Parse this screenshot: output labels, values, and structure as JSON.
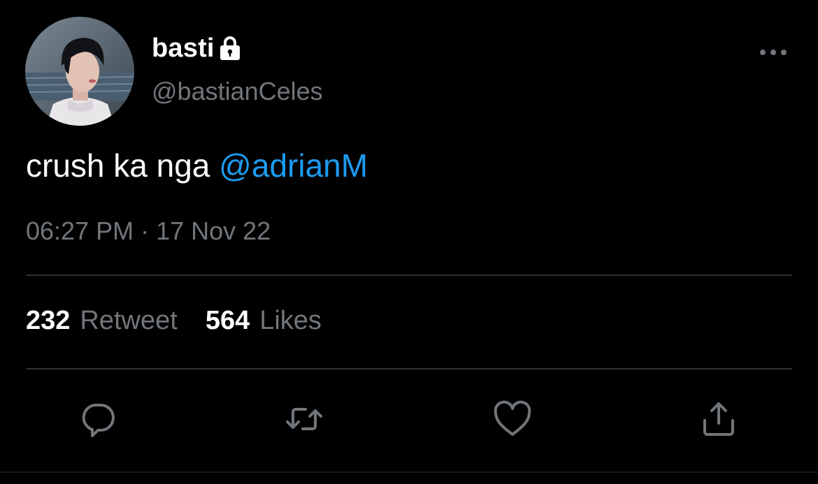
{
  "tweet": {
    "author": {
      "display_name": "basti",
      "handle": "@bastianCeles",
      "protected_icon": "lock-icon"
    },
    "text": "crush ka nga ",
    "mention": "@adrianM",
    "timestamp": "06:27 PM · 17 Nov 22",
    "stats": {
      "retweets_count": "232",
      "retweets_label": "Retweet",
      "likes_count": "564",
      "likes_label": "Likes"
    },
    "actions": [
      {
        "name": "reply",
        "icon": "speech-bubble-icon"
      },
      {
        "name": "retweet",
        "icon": "retweet-arrows-icon"
      },
      {
        "name": "like",
        "icon": "heart-icon"
      },
      {
        "name": "share",
        "icon": "share-upload-icon"
      }
    ]
  },
  "colors": {
    "background": "#000000",
    "primary_text": "#ffffff",
    "secondary_text": "#71767b",
    "accent": "#1d9bf0",
    "divider": "#2f3336"
  }
}
